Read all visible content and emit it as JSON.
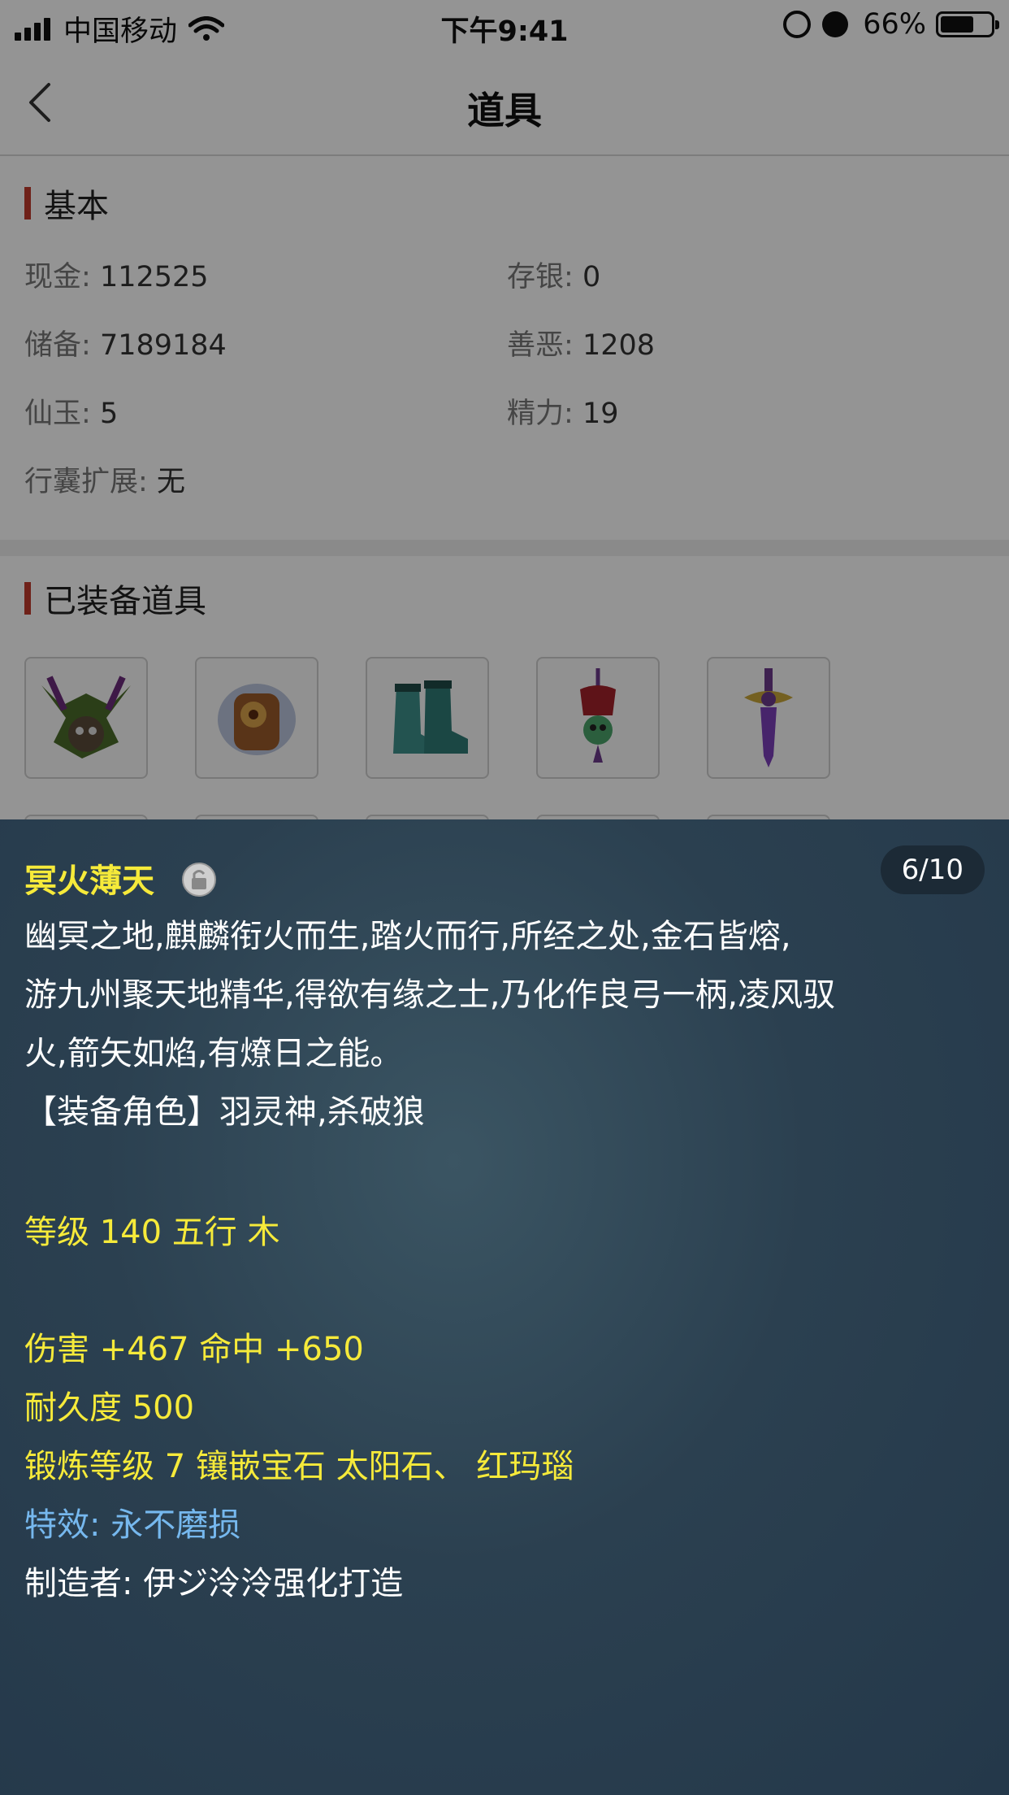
{
  "status_bar": {
    "carrier": "中国移动",
    "time": "下午9:41",
    "battery": "66%"
  },
  "nav": {
    "title": "道具"
  },
  "basic": {
    "section_title": "基本",
    "cash_label": "现金:",
    "cash_value": "112525",
    "deposit_label": "存银:",
    "deposit_value": "0",
    "reserve_label": "储备:",
    "reserve_value": "7189184",
    "karma_label": "善恶:",
    "karma_value": "1208",
    "jade_label": "仙玉:",
    "jade_value": "5",
    "energy_label": "精力:",
    "energy_value": "19",
    "bag_label": "行囊扩展:",
    "bag_value": "无"
  },
  "equipped": {
    "section_title": "已装备道具",
    "items": [
      "helmet-icon",
      "armor-icon",
      "boots-icon",
      "necklace-icon",
      "sword-icon"
    ]
  },
  "detail": {
    "counter": "6/10",
    "name": "冥火薄天",
    "desc_line1": "幽冥之地,麒麟衔火而生,踏火而行,所经之处,金石皆熔,",
    "desc_line2": "游九州聚天地精华,得欲有缘之士,乃化作良弓一柄,凌风驭",
    "desc_line3": "火,箭矢如焰,有燎日之能。",
    "role": "【装备角色】羽灵神,杀破狼",
    "level": "等级 140 五行 木",
    "damage": "伤害 +467 命中 +650",
    "durability": "耐久度 500",
    "forge": "锻炼等级 7 镶嵌宝石 太阳石、 红玛瑙",
    "effect_label": "特效:",
    "effect_value": "永不磨损",
    "maker": "制造者: 伊ジ泠泠强化打造"
  }
}
